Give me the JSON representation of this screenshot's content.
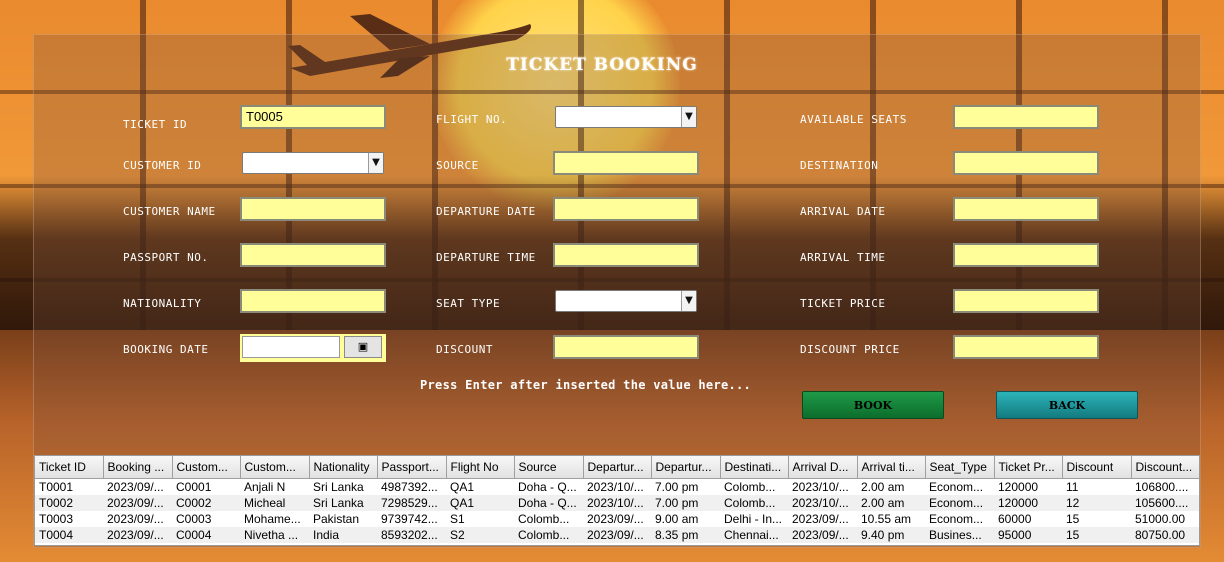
{
  "title": "TICKET BOOKING",
  "labels": {
    "ticket_id": "TICKET ID",
    "customer_id": "CUSTOMER ID",
    "customer_name": "CUSTOMER NAME",
    "passport_no": "PASSPORT NO.",
    "nationality": "NATIONALITY",
    "booking_date": "BOOKING DATE",
    "flight_no": "FLIGHT NO.",
    "source": "SOURCE",
    "departure_date": "DEPARTURE DATE",
    "departure_time": "DEPARTURE TIME",
    "seat_type": "SEAT TYPE",
    "discount": "DISCOUNT",
    "available_seats": "AVAILABLE SEATS",
    "destination": "DESTINATION",
    "arrival_date": "ARRIVAL DATE",
    "arrival_time": "ARRIVAL TIME",
    "ticket_price": "TICKET PRICE",
    "discount_price": "DISCOUNT PRICE"
  },
  "values": {
    "ticket_id": "T0005"
  },
  "hint": "Press Enter after inserted the value here...",
  "buttons": {
    "book": "BOOK",
    "back": "BACK"
  },
  "icons": {
    "dropdown": "chevron-down-icon",
    "calendar": "calendar-icon"
  },
  "colors": {
    "field_bg": "#fffe99",
    "book_btn": "#168a3c",
    "back_btn": "#1f9ea3"
  },
  "table": {
    "columns": [
      "Ticket ID",
      "Booking ...",
      "Custom...",
      "Custom...",
      "Nationality",
      "Passport...",
      "Flight No",
      "Source",
      "Departur...",
      "Departur...",
      "Destinati...",
      "Arrival D...",
      "Arrival ti...",
      "Seat_Type",
      "Ticket Pr...",
      "Discount",
      "Discount..."
    ],
    "rows": [
      [
        "T0001",
        "2023/09/...",
        "C0001",
        "Anjali N",
        "Sri Lanka",
        "4987392...",
        "QA1",
        "Doha - Q...",
        "2023/10/...",
        "7.00 pm",
        "Colomb...",
        "2023/10/...",
        "2.00 am",
        "Econom...",
        "120000",
        "11",
        "106800...."
      ],
      [
        "T0002",
        "2023/09/...",
        "C0002",
        "Micheal",
        "Sri Lanka",
        "7298529...",
        "QA1",
        "Doha - Q...",
        "2023/10/...",
        "7.00 pm",
        "Colomb...",
        "2023/10/...",
        "2.00 am",
        "Econom...",
        "120000",
        "12",
        "105600...."
      ],
      [
        "T0003",
        "2023/09/...",
        "C0003",
        "Mohame...",
        "Pakistan",
        "9739742...",
        "S1",
        "Colomb...",
        "2023/09/...",
        "9.00 am",
        "Delhi - In...",
        "2023/09/...",
        "10.55 am",
        "Econom...",
        "60000",
        "15",
        "51000.00"
      ],
      [
        "T0004",
        "2023/09/...",
        "C0004",
        "Nivetha ...",
        "India",
        "8593202...",
        "S2",
        "Colomb...",
        "2023/09/...",
        "8.35 pm",
        "Chennai...",
        "2023/09/...",
        "9.40 pm",
        "Busines...",
        "95000",
        "15",
        "80750.00"
      ]
    ]
  }
}
